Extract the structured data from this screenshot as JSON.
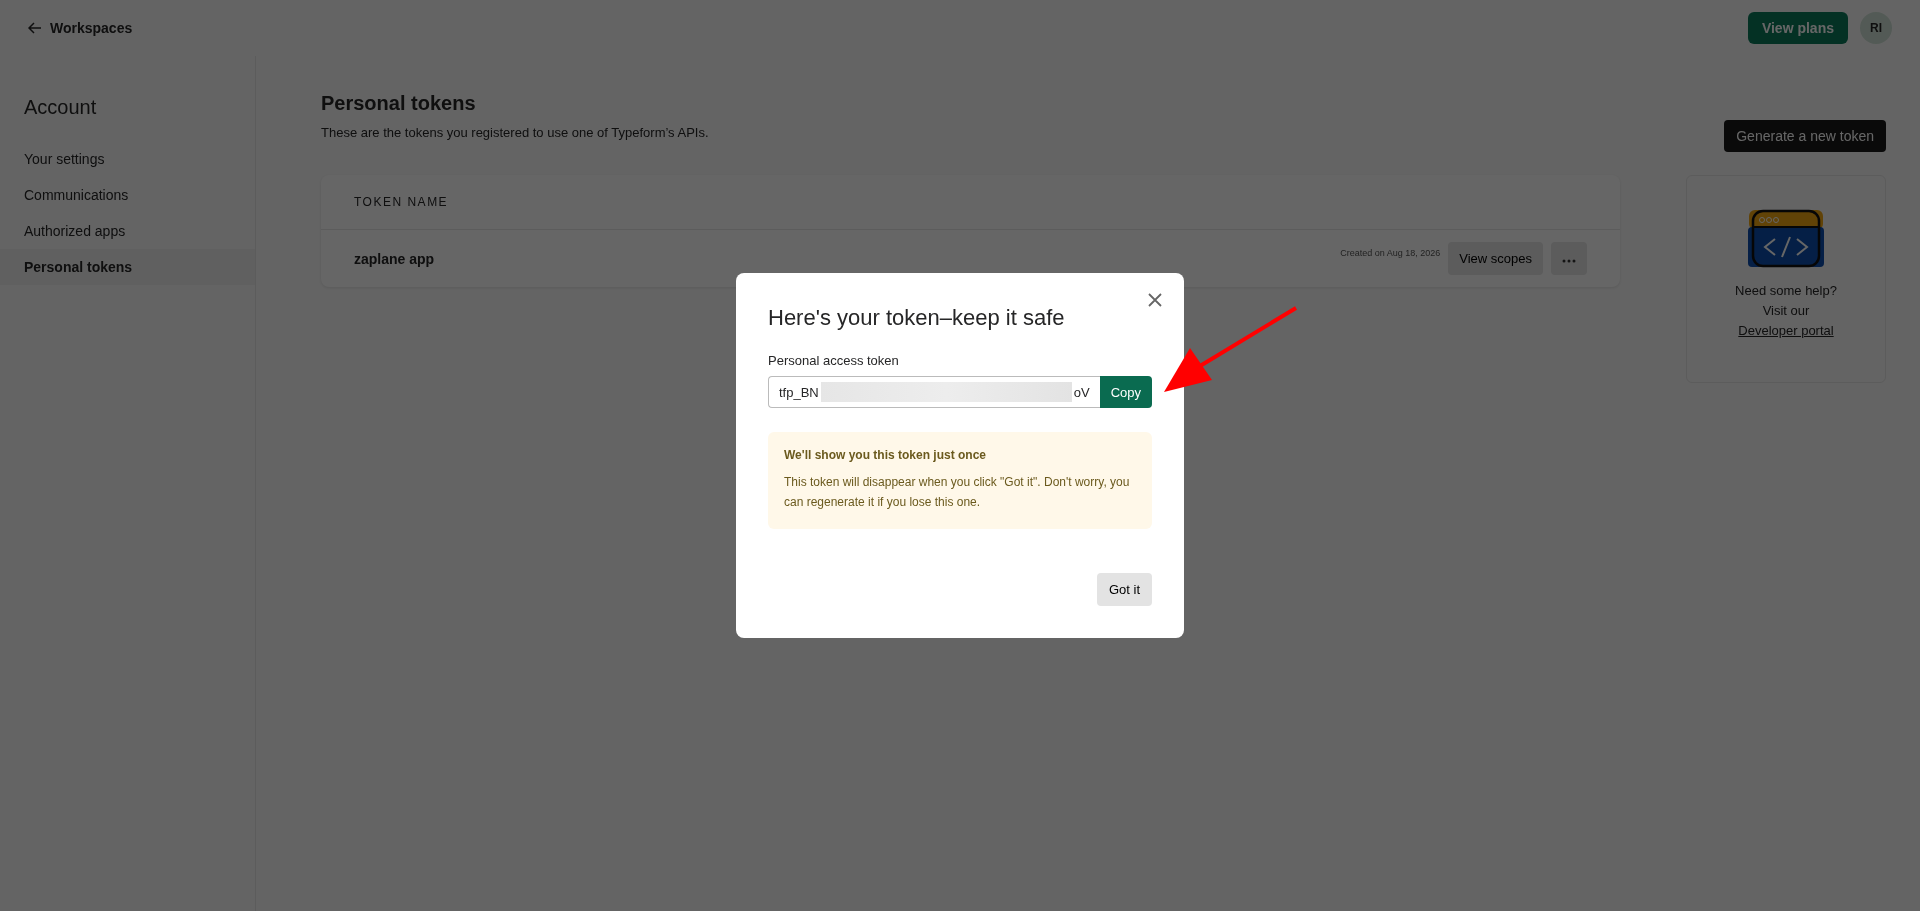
{
  "top_bar": {
    "back_link": "Workspaces",
    "view_plans": "View plans",
    "avatar": "RI"
  },
  "sidebar": {
    "title": "Account",
    "items": [
      {
        "label": "Your settings",
        "selected": false
      },
      {
        "label": "Communications",
        "selected": false
      },
      {
        "label": "Authorized apps",
        "selected": false
      },
      {
        "label": "Personal tokens",
        "selected": true
      }
    ]
  },
  "main": {
    "title": "Personal tokens",
    "subtitle": "These are the tokens you registered to use one of Typeform’s APIs.",
    "generate_button": "Generate a new token",
    "table": {
      "columns": [
        "TOKEN NAME"
      ],
      "rows": [
        {
          "name": "zaplane app",
          "created": "Created on Aug 18, 2026",
          "view_scopes": "View scopes"
        }
      ]
    }
  },
  "help_card": {
    "line_1": "Need some help?",
    "line_2": "Visit our",
    "link": "Developer portal"
  },
  "modal": {
    "title": "Here's your token–keep it safe",
    "field_label": "Personal access token",
    "token_start": "tfp_BN",
    "token_end": "oV",
    "copy_button": "Copy",
    "notice": {
      "title": "We'll show you this token just once",
      "text": "This token will disappear when you click \"Got it\". Don't worry, you can regenerate it if you lose this one."
    },
    "confirm_button": "Got it"
  }
}
